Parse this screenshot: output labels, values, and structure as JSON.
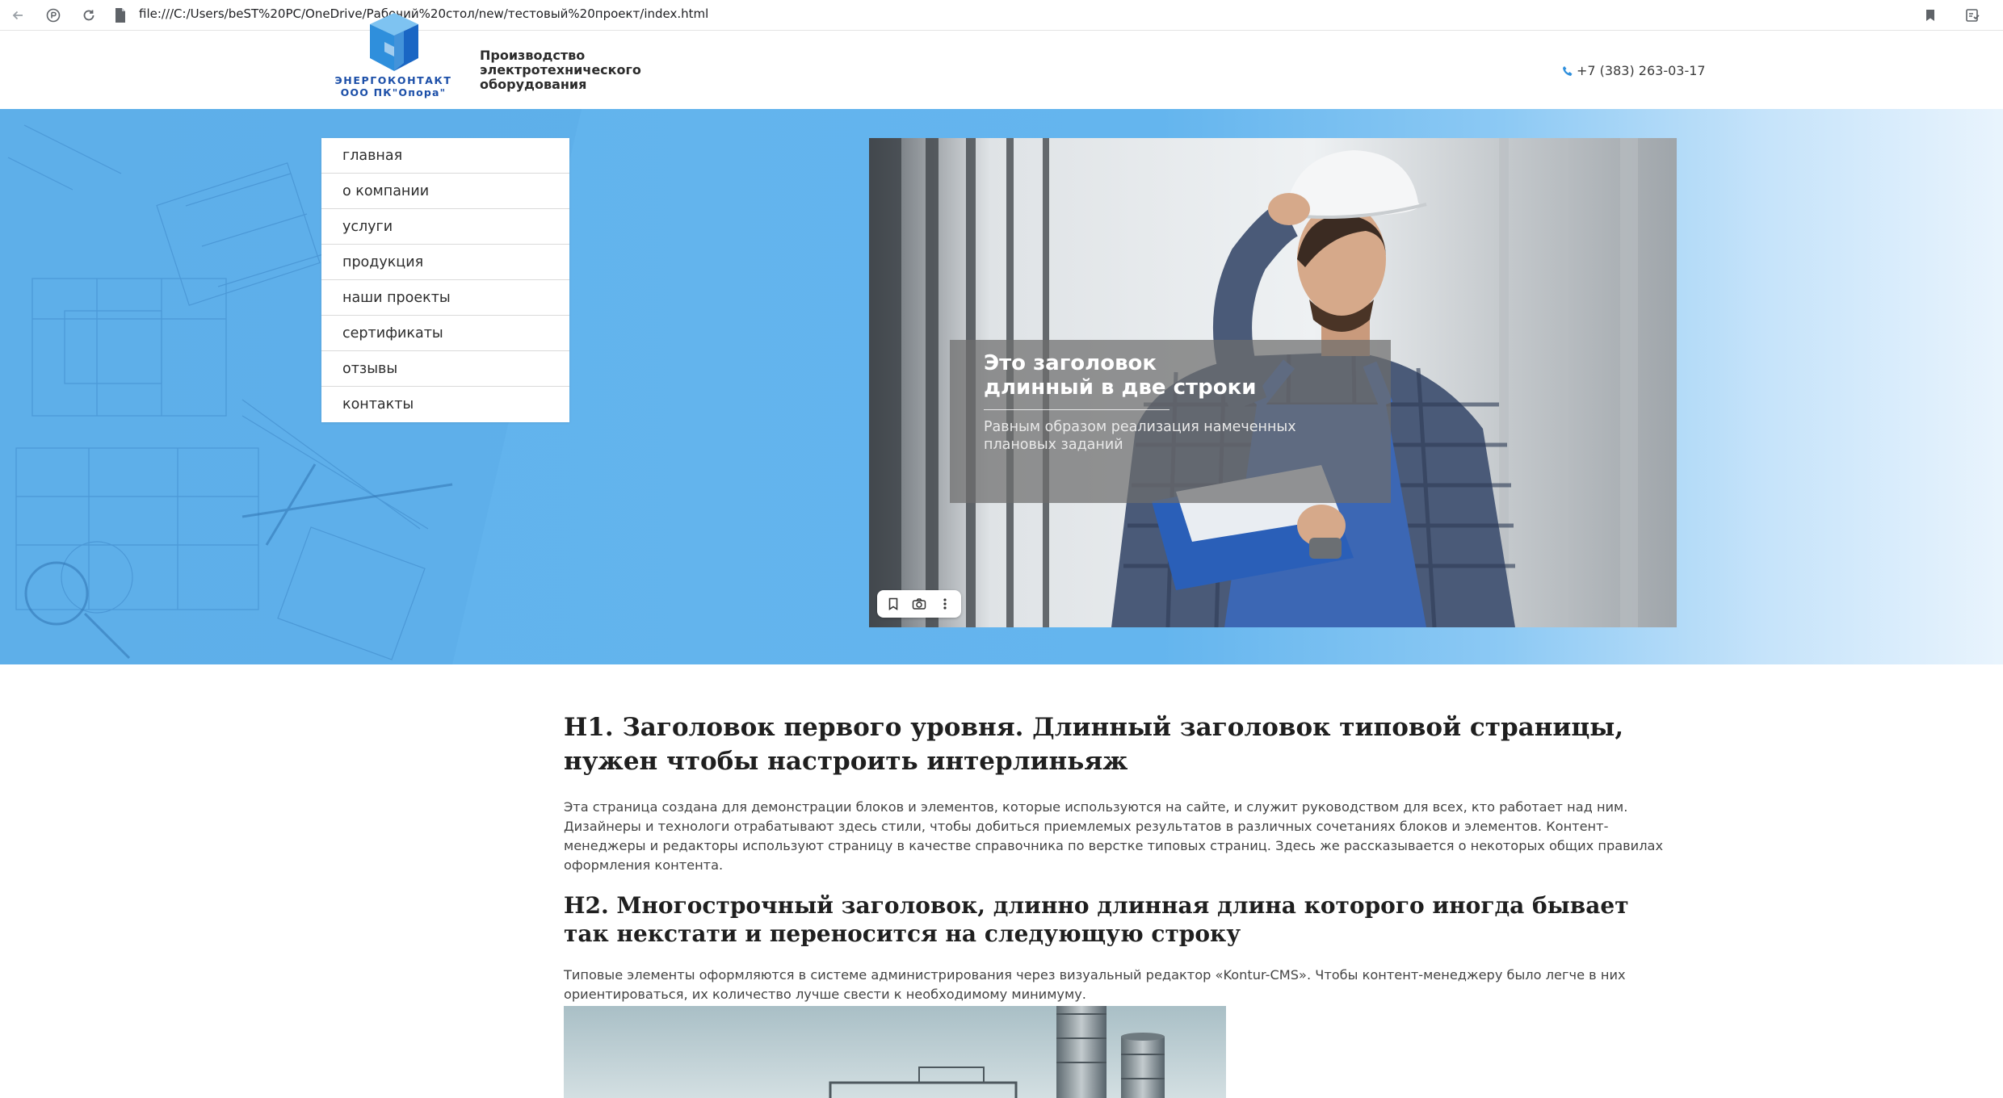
{
  "browser": {
    "url": "file:///C:/Users/beST%20PC/OneDrive/Рабочий%20стол/new/тестовый%20проект/index.html"
  },
  "header": {
    "logo_name": "ЭНЕРГОКОНТАКТ",
    "logo_sub": "ООО ПК\"Опора\"",
    "tagline": "Производство электротехнического оборудования",
    "phone": "+7 (383) 263-03-17"
  },
  "menu": {
    "items": [
      {
        "label": "главная"
      },
      {
        "label": "о компании"
      },
      {
        "label": "услуги"
      },
      {
        "label": "продукция"
      },
      {
        "label": "наши проекты"
      },
      {
        "label": "сертификаты"
      },
      {
        "label": "отзывы"
      },
      {
        "label": "контакты"
      }
    ]
  },
  "slide": {
    "title": "Это заголовок\nдлинный в две строки",
    "text": "Равным образом реализация намеченных\nплановых заданий"
  },
  "content": {
    "h1": "H1. Заголовок первого уровня. Длинный заголовок типовой страницы, нужен чтобы настроить интерлиньяж",
    "p1": "Эта страница создана для демонстрации блоков и элементов, которые используются на сайте, и служит руководством для всех, кто работает над ним. Дизайнеры и технологи отрабатывают здесь стили, чтобы добиться приемлемых результатов в различных сочетаниях блоков и элементов. Контент-менеджеры и редакторы используют страницу в качестве справочника по верстке типовых страниц. Здесь же рассказывается о некоторых общих правилах оформления контента.",
    "h2": "H2. Многострочный заголовок, длинно длинная длина которого иногда бывает так некстати и переносится на следующую строку",
    "p2": "Типовые элементы оформляются в системе администрирования через визуальный редактор «Kontur-CMS». Чтобы контент-менеджеру было легче в них ориентироваться, их количество лучше свести к необходимому минимуму."
  },
  "colors": {
    "brand_blue": "#1c4fa8",
    "hero_blue": "#61b2ec",
    "phone_icon": "#2f8fdc"
  },
  "icons": {
    "back": "back-arrow-icon",
    "extension": "extension-icon",
    "reload": "reload-icon",
    "file": "file-icon",
    "bookmark": "bookmark-icon",
    "reading_list": "reading-list-icon",
    "phone": "phone-icon",
    "slide_save": "bookmark-icon",
    "slide_camera": "camera-icon",
    "slide_more": "more-vertical-icon"
  }
}
